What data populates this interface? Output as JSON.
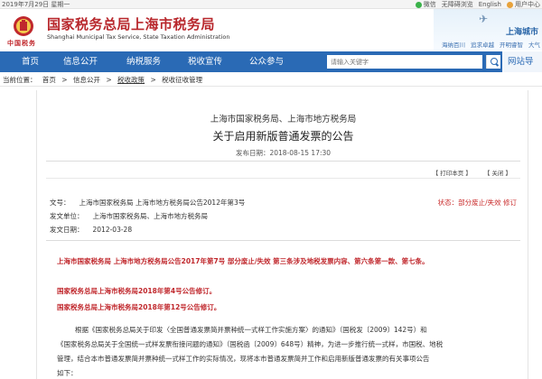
{
  "topbar": {
    "date": "2019年7月29日 星期一",
    "links": [
      "微信",
      "无障碍浏览",
      "English",
      "用户中心"
    ]
  },
  "header": {
    "emblem_text": "中国税务",
    "title": "国家税务总局上海市税务局",
    "subtitle": "Shanghai Municipal Tax Service, State Taxation Administration",
    "side_title": "上海城市",
    "side_links": [
      "海纳百川",
      "追求卓越",
      "开明睿智",
      "大气"
    ]
  },
  "nav": {
    "items": [
      "首页",
      "信息公开",
      "纳税服务",
      "税收宣传",
      "公众参与"
    ],
    "search_placeholder": "请输入关键字",
    "site_nav": "网站导"
  },
  "breadcrumb": {
    "label": "当前位置：",
    "items": [
      "首页",
      ">",
      "信息公开",
      ">",
      "税收政策",
      ">",
      "税收征收管理"
    ]
  },
  "article": {
    "issuer": "上海市国家税务局、上海市地方税务局",
    "title": "关于启用新版普通发票的公告",
    "publish_time": "发布日期：2018-08-15 17:30",
    "print_label": "【 打印本页 】",
    "close_label": "【 关闭 】",
    "doc_number_label": "文号：",
    "doc_number": "上海市国家税务局 上海市地方税务局公告2012年第3号",
    "status": "状态：部分废止/失效 修订",
    "issuer_label": "发文单位：",
    "issuer_value": "上海市国家税务局、上海市地方税务局",
    "date_label": "发文日期：",
    "date_value": "2012-03-28",
    "red_notes": [
      "上海市国家税务局 上海市地方税务局公告2017年第7号 部分废止/失效 第三条涉及地税发票内容、第六条第一款、第七条。",
      "国家税务总局上海市税务局2018年第4号公告修订。",
      "国家税务总局上海市税务局2018年第12号公告修订。"
    ],
    "body_lines": [
      "根据《国家税务总局关于印发〈全国普通发票简并票种统一式样工作实施方案〉的通知》（国税发〔2009〕142号）和",
      "《国家税务总局关于全国统一式样发票衔接问题的通知》（国税函〔2009〕648号）精神，为进一步推行统一式样，市国税、地税",
      "管理，结合本市普通发票简并票种统一式样工作的实际情况，现将本市普通发票简并工作和启用新版普通发票的有关事项公告",
      "如下："
    ]
  },
  "colors": {
    "brand_red": "#b8272c",
    "nav_blue": "#2a6ab5",
    "status_red": "#c92a2a"
  }
}
